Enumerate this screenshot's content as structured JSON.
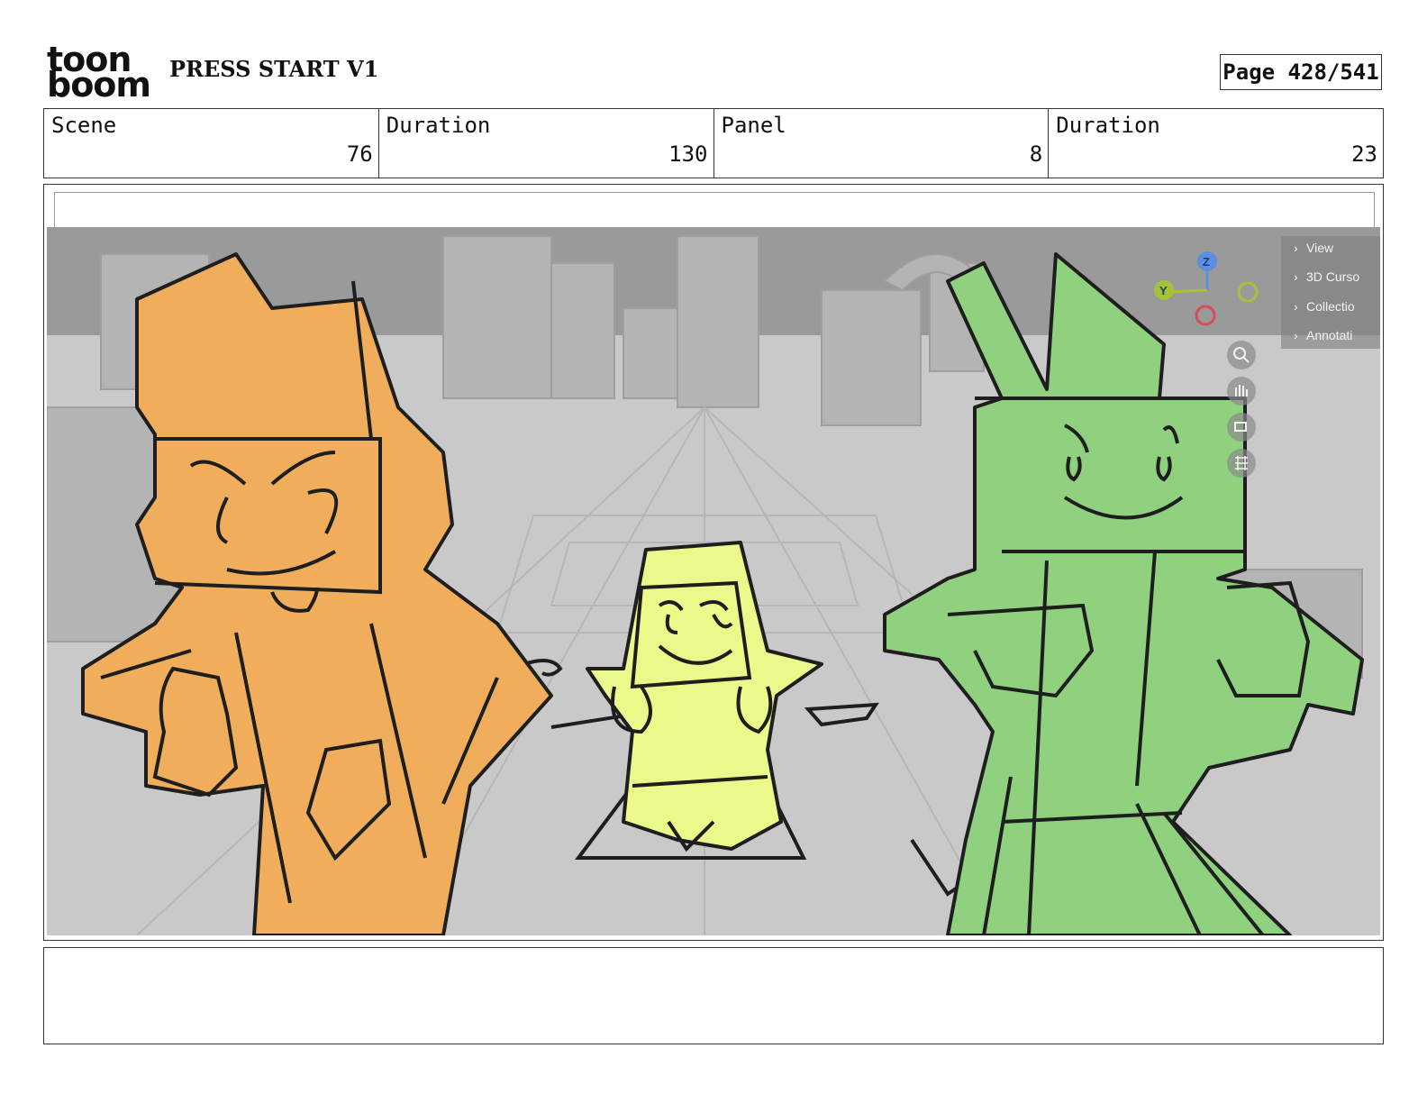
{
  "header": {
    "logo": "toon boom",
    "logo_line1": "toon",
    "logo_line2": "boom",
    "project_title": "PRESS START V1",
    "page_label": "Page 428/541"
  },
  "info": {
    "scene_label": "Scene",
    "scene_value": "76",
    "scene_duration_label": "Duration",
    "scene_duration_value": "130",
    "panel_label": "Panel",
    "panel_value": "8",
    "panel_duration_label": "Duration",
    "panel_duration_value": "23"
  },
  "viewport_ui": {
    "menu_items": [
      "View",
      "3D Curso",
      "Collectio",
      "Annotati"
    ],
    "gizmo_z": "Z",
    "gizmo_y": "Y",
    "tool_icons": [
      "zoom-icon",
      "hand-icon",
      "camera-icon",
      "grid-icon"
    ]
  },
  "notes": {
    "text": ""
  },
  "colors": {
    "orange_character": "#f0ad5c",
    "yellow_character": "#eaf98a",
    "green_character": "#8fd17f",
    "background_gray": "#c9c9c9",
    "sky_gray": "#9a9a9a",
    "line": "#1e1e1e"
  }
}
